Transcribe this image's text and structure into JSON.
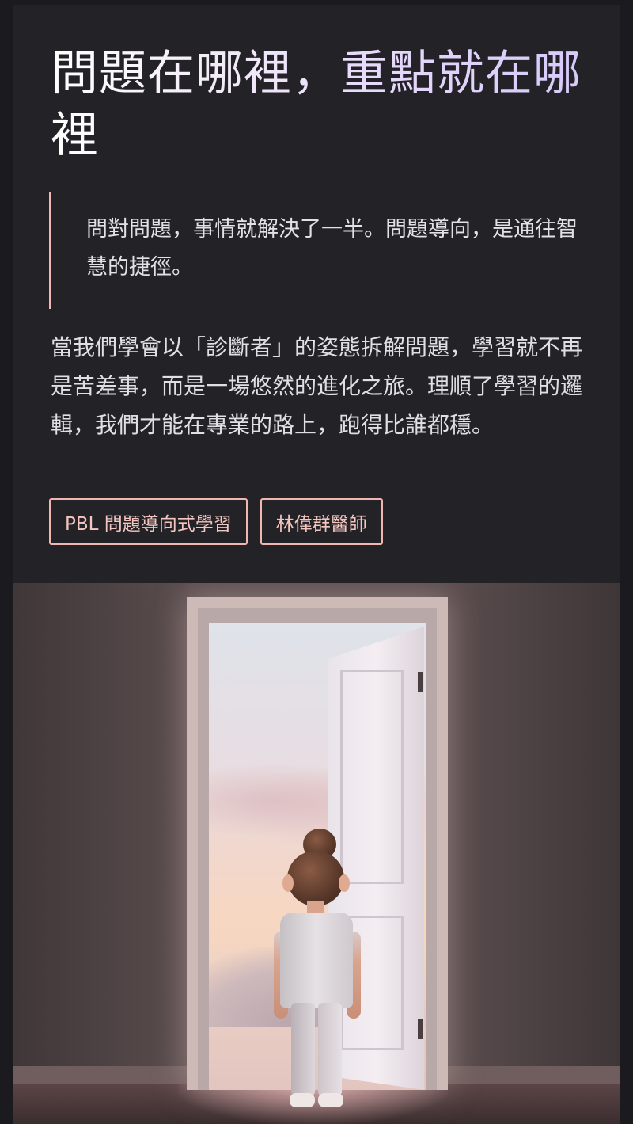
{
  "article": {
    "title": "問題在哪裡，重點就在哪裡",
    "quote": "問對問題，事情就解決了一半。問題導向，是通往智慧的捷徑。",
    "body": "當我們學會以「診斷者」的姿態拆解問題，學習就不再是苦差事，而是一場悠然的進化之旅。理順了學習的邏輯，我們才能在專業的路上，跑得比誰都穩。",
    "tags": [
      "PBL 問題導向式學習",
      "林偉群醫師"
    ]
  },
  "colors": {
    "background": "#232327",
    "accent": "#f0b6b0",
    "title_gradient_end": "#d6c8fb"
  }
}
